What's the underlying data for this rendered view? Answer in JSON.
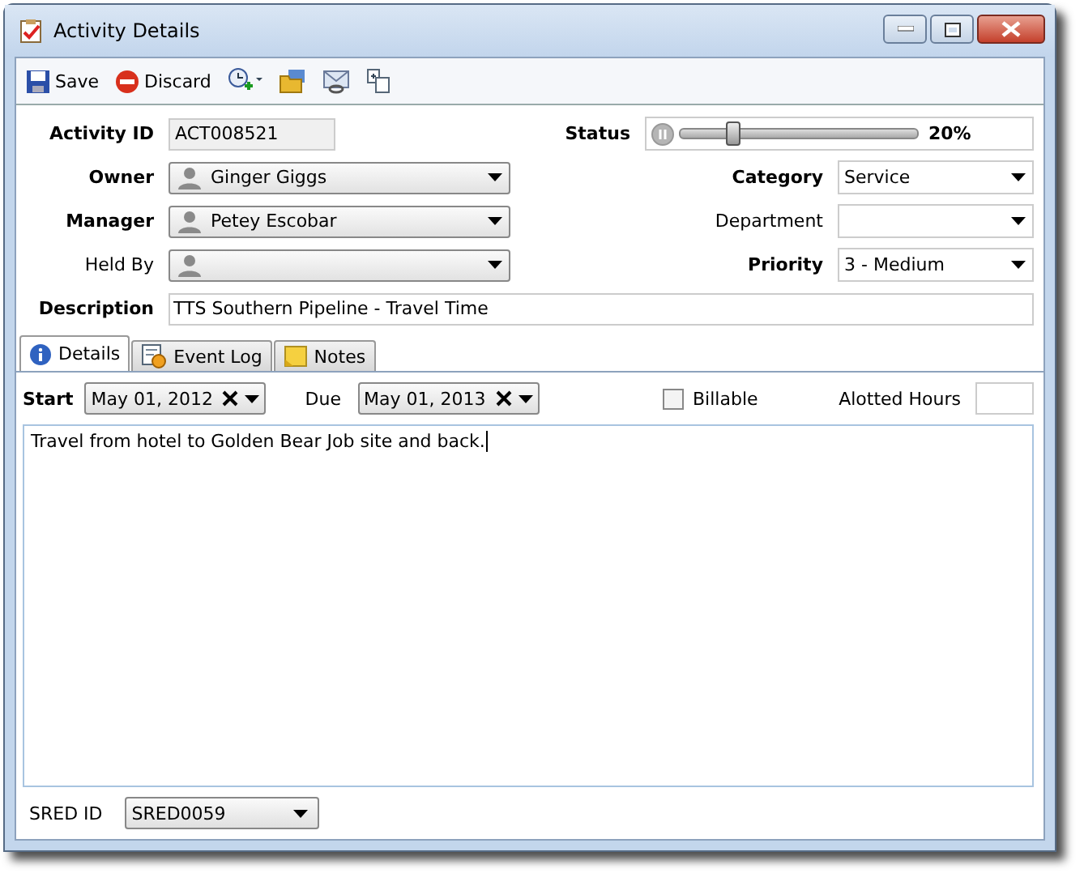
{
  "window": {
    "title": "Activity Details"
  },
  "toolbar": [
    {
      "kind": "save",
      "label": "Save"
    },
    {
      "kind": "discard",
      "label": "Discard"
    },
    {
      "kind": "clock"
    },
    {
      "kind": "folder"
    },
    {
      "kind": "mail"
    },
    {
      "kind": "copy"
    }
  ],
  "form": {
    "rows": [
      {
        "left": {
          "label": "Activity ID",
          "required": true,
          "kind": "readonly",
          "value": "ACT008521"
        },
        "right": {
          "label": "Status",
          "required": true,
          "kind": "slider",
          "level": 0.2,
          "reading": "20%"
        }
      },
      {
        "left": {
          "label": "Owner",
          "required": true,
          "kind": "person",
          "value": "Ginger Giggs"
        },
        "right": {
          "label": "Category",
          "required": true,
          "kind": "select",
          "value": "Service"
        }
      },
      {
        "left": {
          "label": "Manager",
          "required": true,
          "kind": "person",
          "value": "Petey Escobar"
        },
        "right": {
          "label": "Department",
          "required": false,
          "kind": "select"
        }
      },
      {
        "left": {
          "label": "Held By",
          "required": false,
          "kind": "person"
        },
        "right": {
          "label": "Priority",
          "required": true,
          "kind": "select",
          "value": "3 - Medium"
        }
      }
    ],
    "description": {
      "label": "Description",
      "required": true,
      "value": "TTS Southern Pipeline - Travel Time"
    }
  },
  "tabs": [
    {
      "label": "Details",
      "kind": "info",
      "selected": true
    },
    {
      "label": "Event Log",
      "kind": "log",
      "selected": false
    },
    {
      "label": "Notes",
      "kind": "note",
      "selected": false
    }
  ],
  "details": {
    "start": {
      "label": "Start",
      "value": "May 01, 2012"
    },
    "due": {
      "label": "Due",
      "value": "May 01, 2013"
    },
    "billable": {
      "label": "Billable",
      "checked": false
    },
    "hours": {
      "label": "Alotted Hours"
    },
    "notes": "Travel from hotel to Golden Bear Job site and back.",
    "sred": {
      "label": "SRED ID",
      "value": "SRED0059"
    }
  }
}
